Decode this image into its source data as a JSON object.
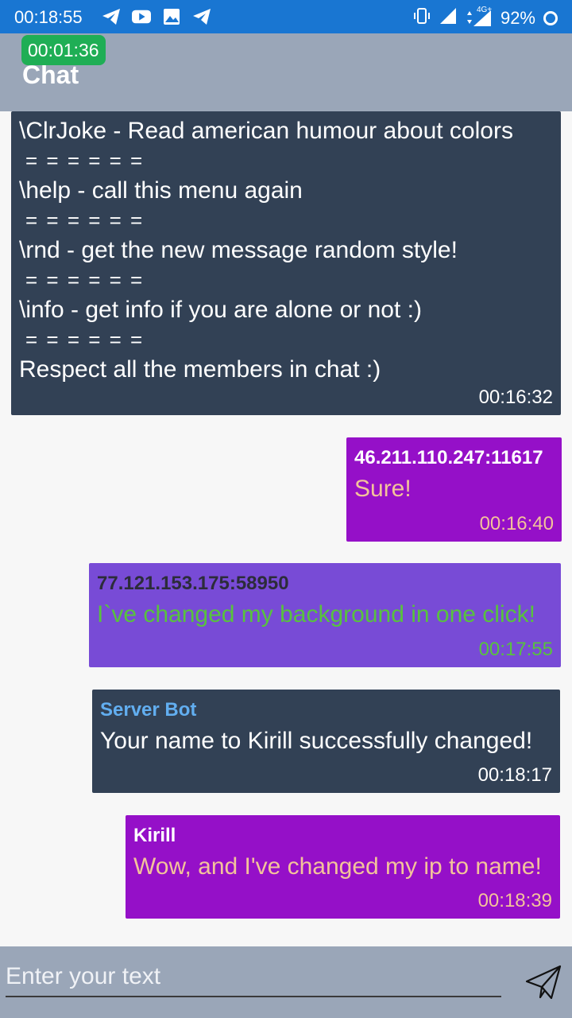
{
  "status_bar": {
    "time": "00:18:55",
    "network": "4G+",
    "battery": "92%",
    "notification_icons": [
      "telegram-icon",
      "youtube-icon",
      "gallery-icon",
      "telegram-icon"
    ]
  },
  "app_bar": {
    "title": "Chat",
    "timer": "00:01:36"
  },
  "bot_message": {
    "lines": [
      "\\ClrJoke - Read american humour about colors",
      "= = = = = =",
      "\\help - call this menu again",
      "= = = = = =",
      "\\rnd - get the new message random style!",
      "= = = = = =",
      "\\info - get info if you are alone or not :)",
      "= = = = = =",
      "Respect all the members in chat :)"
    ],
    "time": "00:16:32"
  },
  "messages": [
    {
      "sender": "46.211.110.247:11617",
      "text": "Sure!",
      "time": "00:16:40"
    },
    {
      "sender": "77.121.153.175:58950",
      "text": "I`ve changed my background in one click!",
      "time": "00:17:55"
    },
    {
      "sender": "Server Bot",
      "text": "Your name to Kirill successfully changed!",
      "time": "00:18:17"
    },
    {
      "sender": "Kirill",
      "text": "Wow, and I've changed my ip to name!",
      "time": "00:18:39"
    }
  ],
  "composer": {
    "placeholder": "Enter your text",
    "value": ""
  },
  "colors": {
    "status_bar": "#1976d2",
    "app_bar": "#9aa6b8",
    "timer_badge": "#1fae55",
    "dark_bubble": "#324155",
    "purple_bubble": "#9510c8",
    "violet_bubble": "#784bd6"
  }
}
